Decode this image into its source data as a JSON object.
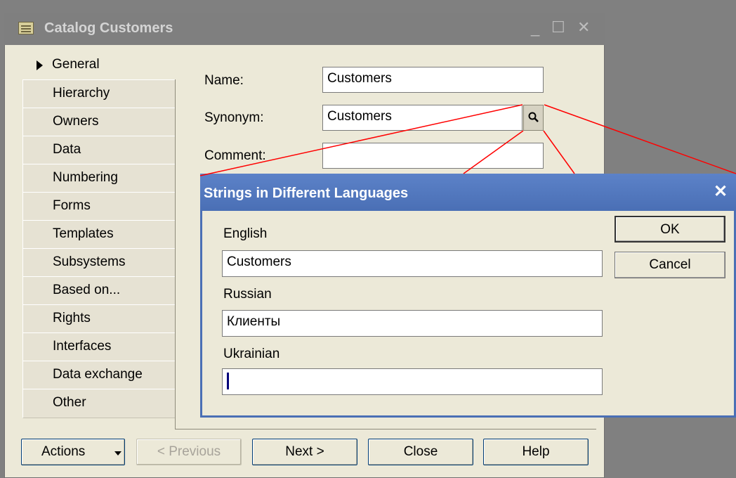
{
  "window": {
    "title": "Catalog Customers",
    "minimize_glyph": "_",
    "maximize_glyph": "☐",
    "close_glyph": "✕",
    "icon": "catalog-icon"
  },
  "tabs": [
    {
      "label": "General",
      "active": true
    },
    {
      "label": "Hierarchy"
    },
    {
      "label": "Owners"
    },
    {
      "label": "Data"
    },
    {
      "label": "Numbering"
    },
    {
      "label": "Forms"
    },
    {
      "label": "Templates"
    },
    {
      "label": "Subsystems"
    },
    {
      "label": "Based on..."
    },
    {
      "label": "Rights"
    },
    {
      "label": "Interfaces"
    },
    {
      "label": "Data exchange"
    },
    {
      "label": "Other"
    }
  ],
  "general": {
    "name_label": "Name:",
    "name_value": "Customers",
    "synonym_label": "Synonym:",
    "synonym_value": "Customers",
    "comment_label": "Comment:",
    "comment_value": "",
    "synonym_button_icon": "magnifier-icon"
  },
  "footer": {
    "actions_label": "Actions",
    "previous_label": "< Previous",
    "next_label": "Next >",
    "close_label": "Close",
    "help_label": "Help"
  },
  "dialog": {
    "title": "Strings in Different Languages",
    "close_glyph": "✕",
    "languages": [
      {
        "label": "English",
        "value": "Customers"
      },
      {
        "label": "Russian",
        "value": "Клиенты"
      },
      {
        "label": "Ukrainian",
        "value": ""
      }
    ],
    "ok_label": "OK",
    "cancel_label": "Cancel"
  },
  "colors": {
    "dialog_title": "#4a6fb5",
    "callout_lines": "#ff0000",
    "window_bg": "#ece9d8"
  }
}
